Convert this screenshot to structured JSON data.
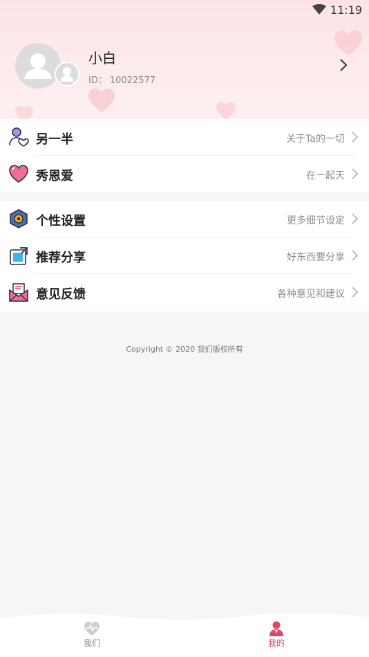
{
  "status_bar": {
    "time": "11:19"
  },
  "profile": {
    "name": "小白",
    "id_label": "ID：",
    "id_value": "10022577"
  },
  "menu_group_1": [
    {
      "label": "另一半",
      "hint": "关于Ta的一切",
      "icon": "couple-person-heart-icon"
    },
    {
      "label": "秀恩爱",
      "hint": "在一起天",
      "icon": "heart-icon"
    }
  ],
  "menu_group_2": [
    {
      "label": "个性设置",
      "hint": "更多细节设定",
      "icon": "hexagon-settings-icon"
    },
    {
      "label": "推荐分享",
      "hint": "好东西要分享",
      "icon": "share-icon"
    },
    {
      "label": "意见反馈",
      "hint": "各种意见和建议",
      "icon": "feedback-mail-icon"
    }
  ],
  "copyright": "Copyright © 2020 我们版权所有",
  "tabbar": {
    "tabs": [
      {
        "label": "我们",
        "icon": "heart-pulse-icon",
        "active": false
      },
      {
        "label": "我的",
        "icon": "person-icon",
        "active": true
      }
    ]
  },
  "colors": {
    "accent": "#e8416a",
    "header_bg": "#fde3e6",
    "page_bg": "#f6f6f6"
  }
}
